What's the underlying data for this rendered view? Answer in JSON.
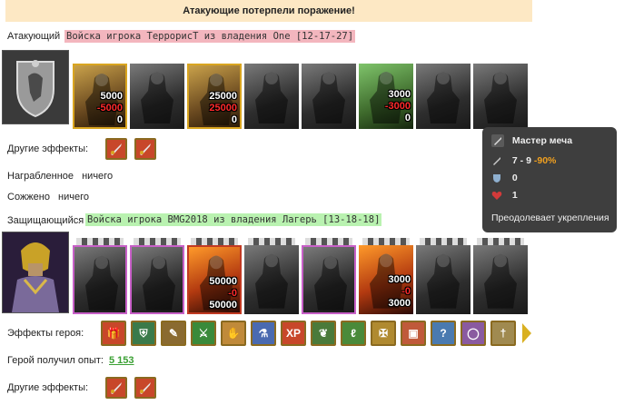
{
  "banner": "Атакующие потерпели поражение!",
  "attacker": {
    "label": "Атакующий",
    "army": "Войска игрока ТеррорисТ из владения One [12-17-27]",
    "units": [
      {
        "frame": "gold",
        "tone": "color",
        "lines": [
          {
            "t": "5000",
            "c": "w"
          },
          {
            "t": "-5000",
            "c": "r"
          },
          {
            "t": "0",
            "c": "w"
          }
        ]
      },
      {
        "frame": "none",
        "tone": "gray",
        "lines": []
      },
      {
        "frame": "gold",
        "tone": "color",
        "lines": [
          {
            "t": "25000",
            "c": "w"
          },
          {
            "t": "25000",
            "c": "r"
          },
          {
            "t": "0",
            "c": "w"
          }
        ]
      },
      {
        "frame": "none",
        "tone": "gray",
        "lines": []
      },
      {
        "frame": "none",
        "tone": "gray",
        "lines": []
      },
      {
        "frame": "none",
        "tone": "green",
        "lines": [
          {
            "t": "3000",
            "c": "w"
          },
          {
            "t": "-3000",
            "c": "r"
          },
          {
            "t": "0",
            "c": "w"
          }
        ]
      },
      {
        "frame": "none",
        "tone": "gray",
        "lines": []
      },
      {
        "frame": "none",
        "tone": "gray",
        "lines": []
      }
    ],
    "other_effects_label": "Другие эффекты:"
  },
  "loot": {
    "label": "Награбленное",
    "value": "ничего"
  },
  "burned": {
    "label": "Сожжено",
    "value": "ничего"
  },
  "defender": {
    "label": "Защищающийся",
    "army": "Войска игрока BMG2018 из владения Лагерь [13-18-18]",
    "units": [
      {
        "frame": "pink",
        "tone": "gray",
        "lines": []
      },
      {
        "frame": "pink",
        "tone": "gray",
        "lines": []
      },
      {
        "frame": "red",
        "tone": "fire",
        "lines": [
          {
            "t": "50000",
            "c": "w"
          },
          {
            "t": "-0",
            "c": "r"
          },
          {
            "t": "50000",
            "c": "w"
          }
        ]
      },
      {
        "frame": "none",
        "tone": "gray",
        "lines": []
      },
      {
        "frame": "pink",
        "tone": "gray",
        "lines": []
      },
      {
        "frame": "none",
        "tone": "fire",
        "lines": [
          {
            "t": "3000",
            "c": "w"
          },
          {
            "t": "-0",
            "c": "r"
          },
          {
            "t": "3000",
            "c": "w"
          }
        ]
      },
      {
        "frame": "none",
        "tone": "gray",
        "lines": []
      },
      {
        "frame": "none",
        "tone": "gray",
        "lines": []
      }
    ],
    "hero_effects_label": "Эффекты героя:",
    "hero_effects": [
      "gift-icon",
      "shield-icon",
      "scroll-icon",
      "sword-icon",
      "handshake-icon",
      "flask-icon",
      "xp-icon",
      "berries-icon",
      "claw-icon",
      "cross-icon",
      "chest-icon",
      "question-icon",
      "ring-icon",
      "dagger-icon"
    ],
    "xp_label": "Герой получил опыт:",
    "xp_value": "5 153",
    "other_effects_label": "Другие эффекты:"
  },
  "tooltip": {
    "title": "Мастер меча",
    "damage": "7 - 9",
    "damage_mod": "-90%",
    "defense": "0",
    "health": "1",
    "note": "Преодолевает укрепления"
  }
}
